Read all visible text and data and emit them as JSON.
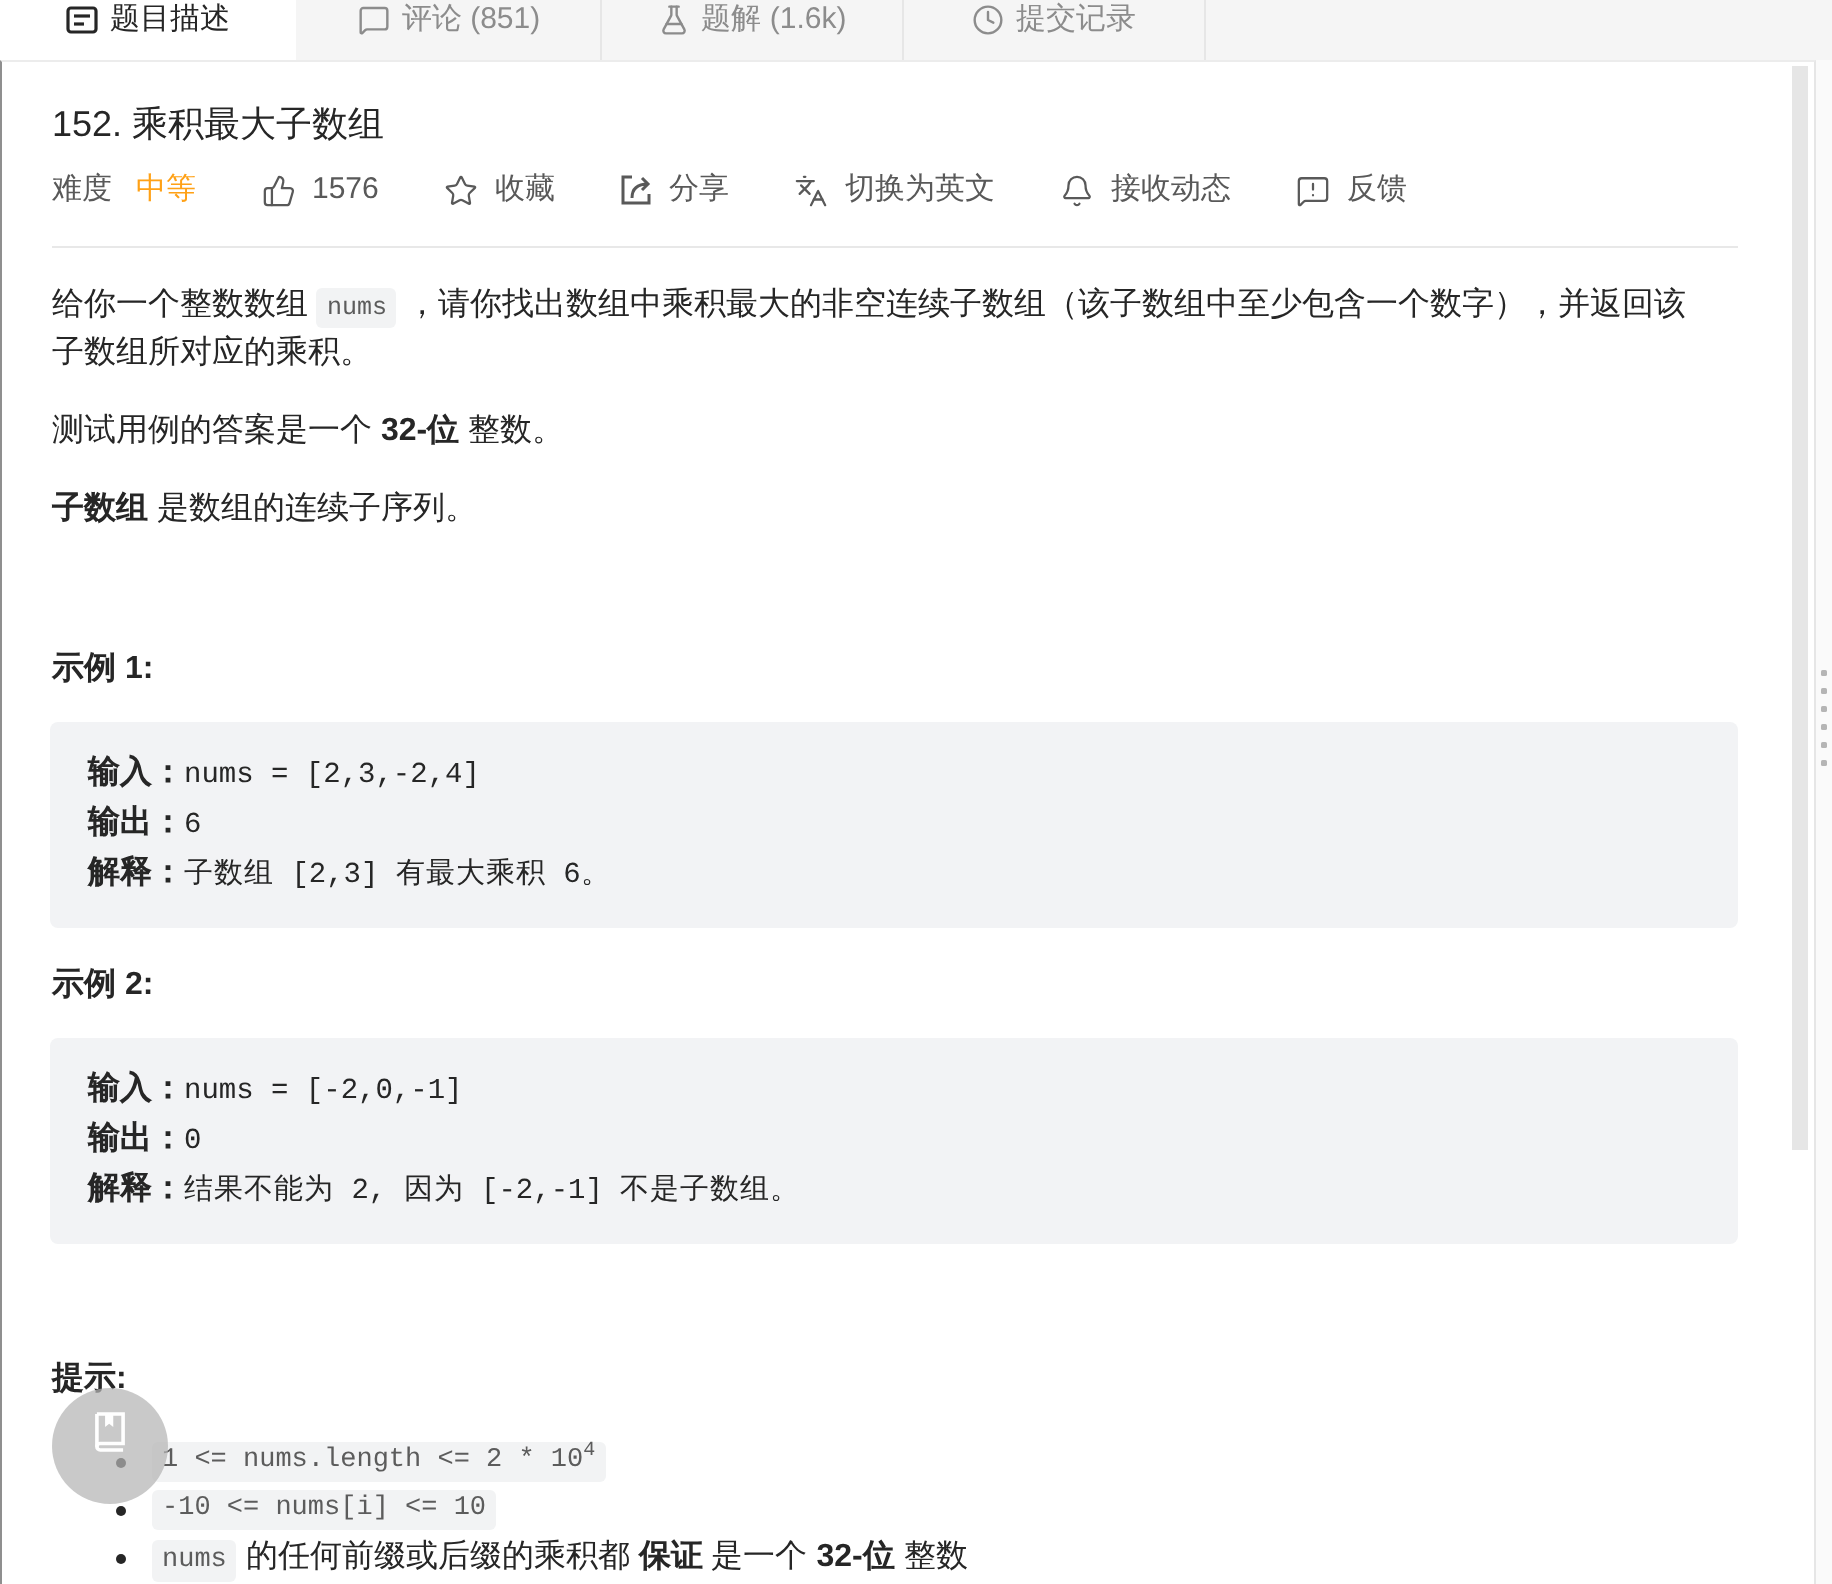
{
  "tabs": [
    {
      "kind": "description",
      "label": "题目描述",
      "selected": true
    },
    {
      "kind": "comments",
      "label": "评论 (851)",
      "selected": false
    },
    {
      "kind": "solutions",
      "label": "题解 (1.6k)",
      "selected": false
    },
    {
      "kind": "submissions",
      "label": "提交记录",
      "selected": false
    }
  ],
  "problem": {
    "title": "152. 乘积最大子数组",
    "difficulty_label": "难度",
    "difficulty": "中等",
    "actions": [
      {
        "kind": "like",
        "label": "1576"
      },
      {
        "kind": "favorite",
        "label": "收藏"
      },
      {
        "kind": "share",
        "label": "分享"
      },
      {
        "kind": "translate",
        "label": "切换为英文"
      },
      {
        "kind": "subscribe",
        "label": "接收动态"
      },
      {
        "kind": "feedback",
        "label": "反馈"
      }
    ]
  },
  "description": [
    {
      "segments": [
        {
          "kind": "text",
          "text": "给你一个整数数组 "
        },
        {
          "kind": "code",
          "text": "nums"
        },
        {
          "kind": "text",
          "text": " ，请你找出数组中乘积最大的非空连续子数组（该子数组中至少包含一个数字），并返回该子数组所对应的乘积。"
        }
      ]
    },
    {
      "segments": [
        {
          "kind": "text",
          "text": "测试用例的答案是一个 **32-位** 整数。"
        }
      ]
    },
    {
      "segments": [
        {
          "kind": "text",
          "text": "**子数组** 是数组的连续子序列。"
        }
      ]
    }
  ],
  "examples": [
    {
      "heading": "示例 1:",
      "lines": [
        "**输入：**nums = [2,3,-2,4]",
        "**输出：**6",
        "**解释：**子数组 [2,3] 有最大乘积 6。"
      ]
    },
    {
      "heading": "示例 2:",
      "lines": [
        "**输入：**nums = [-2,0,-1]",
        "**输出：**0",
        "**解释：**结果不能为 2, 因为 [-2,-1] 不是子数组。"
      ]
    }
  ],
  "constraints": {
    "heading": "提示:",
    "items": [
      {
        "segments": [
          {
            "kind": "code",
            "text": "1 <= nums.length <= 2 * 10$^{4}$"
          }
        ]
      },
      {
        "segments": [
          {
            "kind": "code",
            "text": "-10 <= nums[i] <= 10"
          }
        ]
      },
      {
        "segments": [
          {
            "kind": "code",
            "text": "nums"
          },
          {
            "kind": "text",
            "text": " 的任何前缀或后缀的乘积都 **保证** 是一个 **32-位** 整数"
          }
        ]
      }
    ]
  }
}
